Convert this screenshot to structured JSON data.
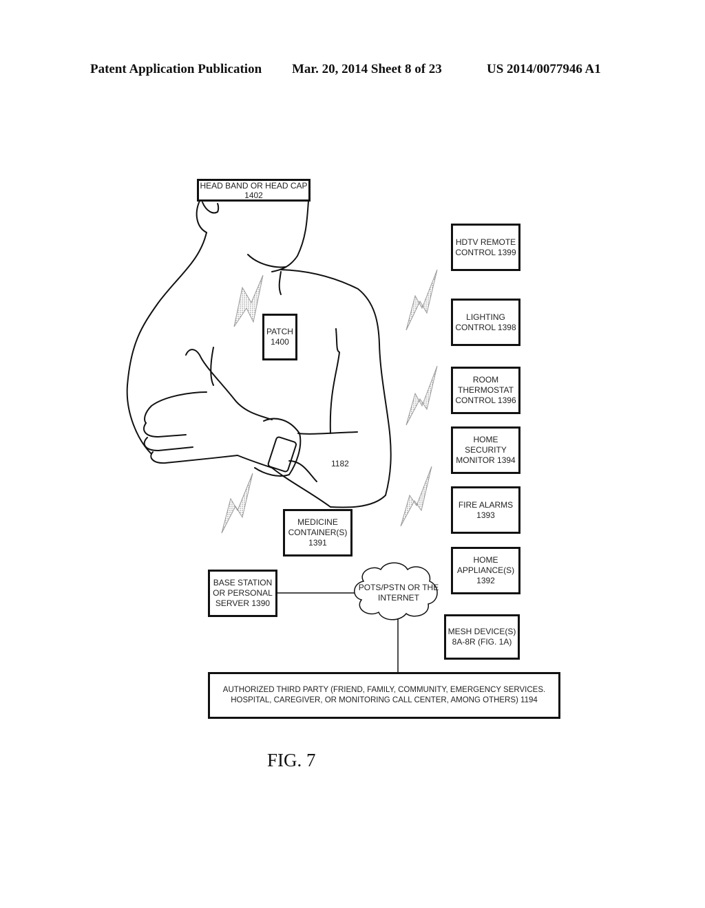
{
  "header": {
    "publication": "Patent Application Publication",
    "date_sheet": "Mar. 20, 2014  Sheet 8 of 23",
    "number": "US 2014/0077946 A1"
  },
  "figure": {
    "caption": "FIG. 7",
    "body_label": "1182",
    "boxes": {
      "head_band": "HEAD BAND OR HEAD CAP\n1402",
      "patch": "PATCH\n1400",
      "hdtv": "HDTV REMOTE\nCONTROL 1399",
      "lighting": "LIGHTING\nCONTROL 1398",
      "thermostat": "ROOM\nTHERMOSTAT\nCONTROL 1396",
      "security": "HOME SECURITY\nMONITOR 1394",
      "fire": "FIRE ALARMS\n1393",
      "appliance": "HOME\nAPPLIANCE(S)\n1392",
      "mesh": "MESH DEVICE(S)\n8A-8R (FIG. 1A)",
      "medicine": "MEDICINE\nCONTAINER(S)\n1391",
      "base_station": "BASE STATION\nOR PERSONAL\nSERVER 1390",
      "third_party": "AUTHORIZED THIRD PARTY (FRIEND, FAMILY, COMMUNITY, EMERGENCY SERVICES.\nHOSPITAL, CAREGIVER, OR MONITORING CALL CENTER, AMONG OTHERS) 1194"
    },
    "cloud": "POTS/PSTN OR THE\nINTERNET"
  }
}
